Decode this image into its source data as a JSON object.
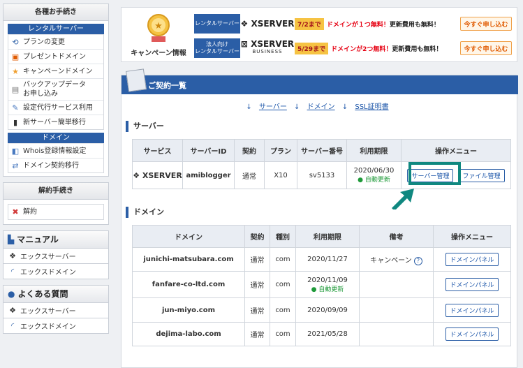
{
  "sidebar": {
    "procedures_title": "各種お手続き",
    "rental_title": "レンタルサーバー",
    "rental_items": [
      "プランの変更",
      "プレゼントドメイン",
      "キャンペーンドメイン",
      "バックアップデータ\nお申し込み",
      "設定代行サービス利用",
      "新サーバー簡単移行"
    ],
    "domain_title": "ドメイン",
    "domain_items": [
      "Whois登録情報設定",
      "ドメイン契約移行"
    ],
    "cancel_title": "解約手続き",
    "cancel_item": "解約",
    "manual_title": "マニュアル",
    "manual_items": [
      "エックスサーバー",
      "エックスドメイン"
    ],
    "faq_title": "よくある質問",
    "faq_items": [
      "エックスサーバー",
      "エックスドメイン"
    ]
  },
  "campaign": {
    "label": "キャンペーン情報",
    "rows": [
      {
        "tag": "レンタルサーバー",
        "logo": "XSERVER",
        "logo_sub": "",
        "date": "7/2まで",
        "text_red": "ドメインが１つ無料！",
        "text": "更新費用も無料！",
        "button": "今すぐ申し込む"
      },
      {
        "tag": "法人向け\nレンタルサーバー",
        "logo": "XSERVER",
        "logo_sub": "BUSINESS",
        "date": "5/29まで",
        "text_red": "ドメインが2つ無料！",
        "text": "更新費用も無料！",
        "button": "今すぐ申し込む"
      }
    ]
  },
  "contracts": {
    "title": "ご契約一覧",
    "anchors": [
      "サーバー",
      "ドメイン",
      "SSL証明書"
    ],
    "server_heading": "サーバー",
    "server_headers": [
      "サービス",
      "サーバーID",
      "契約",
      "プラン",
      "サーバー番号",
      "利用期限",
      "操作メニュー"
    ],
    "server_row": {
      "service": "XSERVER",
      "id": "amiblogger",
      "contract": "通常",
      "plan": "X10",
      "number": "sv5133",
      "expiry": "2020/06/30",
      "auto": "自動更新",
      "btn_manage": "サーバー管理",
      "btn_file": "ファイル管理"
    },
    "domain_heading": "ドメイン",
    "domain_headers": [
      "ドメイン",
      "契約",
      "種別",
      "利用期限",
      "備考",
      "操作メニュー"
    ],
    "domain_rows": [
      {
        "name": "junichi-matsubara.com",
        "contract": "通常",
        "type": "com",
        "expiry": "2020/11/27",
        "auto": "",
        "note": "キャンペーン",
        "button": "ドメインパネル"
      },
      {
        "name": "fanfare-co-ltd.com",
        "contract": "通常",
        "type": "com",
        "expiry": "2020/11/09",
        "auto": "自動更新",
        "note": "",
        "button": "ドメインパネル"
      },
      {
        "name": "jun-miyo.com",
        "contract": "通常",
        "type": "com",
        "expiry": "2020/09/09",
        "auto": "",
        "note": "",
        "button": "ドメインパネル"
      },
      {
        "name": "dejima-labo.com",
        "contract": "通常",
        "type": "com",
        "expiry": "2021/05/28",
        "auto": "",
        "note": "",
        "button": "ドメインパネル"
      }
    ]
  }
}
